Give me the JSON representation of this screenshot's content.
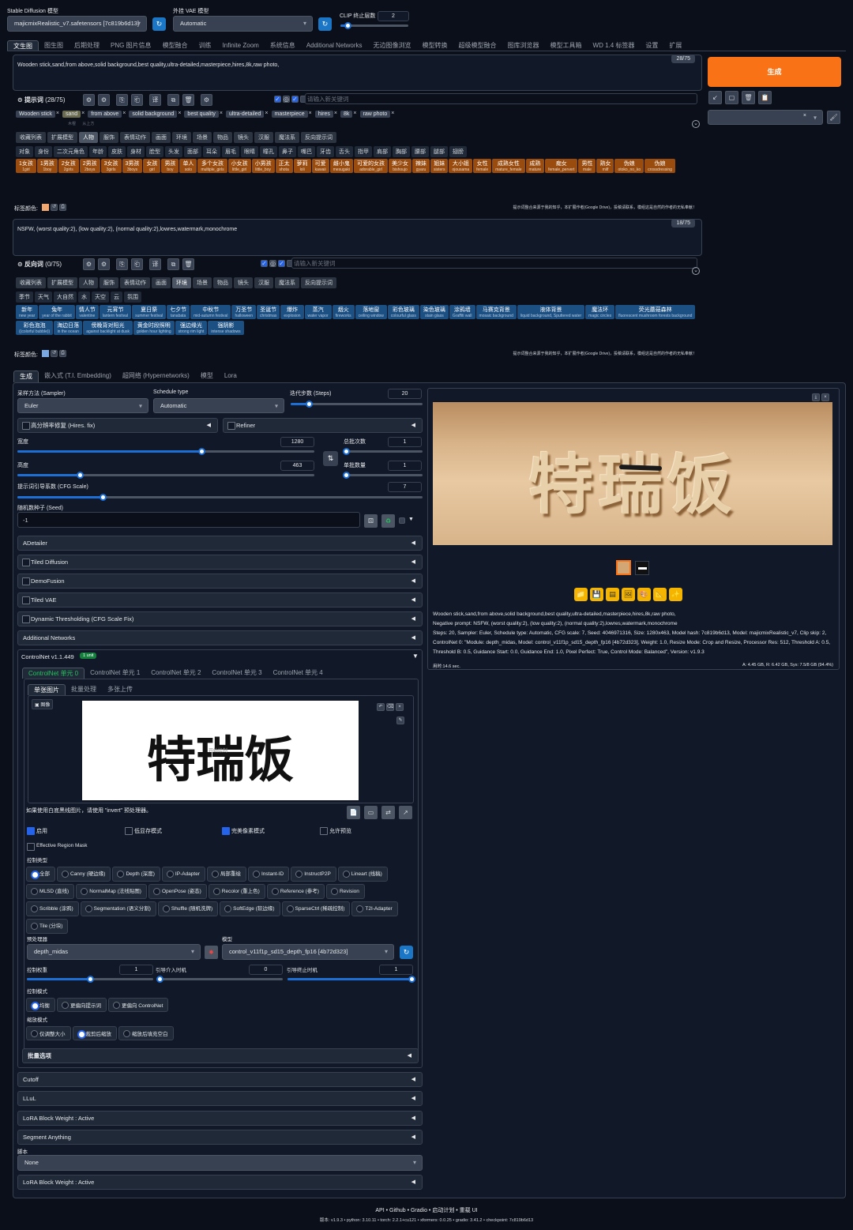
{
  "header": {
    "sd_model_label": "Stable Diffusion 模型",
    "sd_model_value": "majicmixRealistic_v7.safetensors [7c819b6d13]",
    "vae_label": "外挂 VAE 模型",
    "vae_value": "Automatic",
    "clip_label": "CLIP 终止层数",
    "clip_value": "2"
  },
  "tabs": [
    "文生图",
    "图生图",
    "后期处理",
    "PNG 图片信息",
    "模型融合",
    "训练",
    "Infinite Zoom",
    "系统信息",
    "Additional Networks",
    "无边图像浏览",
    "模型转换",
    "超级模型融合",
    "图库浏览器",
    "模型工具箱",
    "WD 1.4 标签器",
    "设置",
    "扩展"
  ],
  "prompt": {
    "text": "Wooden stick,sand,from above,solid background,best quality,ultra-detailed,masterpiece,hires,8k,raw photo,",
    "count": "28/75",
    "label": "提示词",
    "label_count": "(28/75)",
    "keyword_placeholder": "请输入新关键词",
    "chips": [
      "Wooden stick",
      "sand",
      "from above",
      "solid background",
      "best quality",
      "ultra-detailed",
      "masterpiece",
      "hires",
      "8k",
      "raw photo"
    ],
    "chip_subs": [
      "木棍",
      "沙子",
      "从上方"
    ],
    "categories": [
      "收藏列表",
      "扩展模型",
      "人物",
      "服饰",
      "表情动作",
      "画面",
      "环境",
      "场景",
      "物品",
      "镜头",
      "汉服",
      "魔法系",
      "反向提示词"
    ],
    "subcats": [
      "对象",
      "身份",
      "二次元角色",
      "年龄",
      "皮肤",
      "身材",
      "脸型",
      "头发",
      "面部",
      "耳朵",
      "眉毛",
      "眼睛",
      "瞳孔",
      "鼻子",
      "嘴巴",
      "牙齿",
      "舌头",
      "指甲",
      "肩部",
      "胸部",
      "腰部",
      "腿部",
      "翅膀"
    ],
    "tags": [
      [
        "1女孩",
        "1girl"
      ],
      [
        "1男孩",
        "1boy"
      ],
      [
        "2女孩",
        "2girls"
      ],
      [
        "2男孩",
        "2boys"
      ],
      [
        "3女孩",
        "3girls"
      ],
      [
        "3男孩",
        "3boys"
      ],
      [
        "女孩",
        "girl"
      ],
      [
        "男孩",
        "boy"
      ],
      [
        "单人",
        "solo"
      ],
      [
        "多个女孩",
        "multiple_girls"
      ],
      [
        "小女孩",
        "little_girl"
      ],
      [
        "小男孩",
        "little_boy"
      ],
      [
        "正太",
        "shota"
      ],
      [
        "萝莉",
        "loli"
      ],
      [
        "可爱",
        "kawaii"
      ],
      [
        "雌小鬼",
        "mesugaki"
      ],
      [
        "可爱的女孩",
        "adorable_girl"
      ],
      [
        "美少女",
        "bishoujo"
      ],
      [
        "辣妹",
        "gyaru"
      ],
      [
        "姐妹",
        "sisters"
      ],
      [
        "大小姐",
        "ojousama"
      ],
      [
        "女性",
        "female"
      ],
      [
        "成熟女性",
        "mature_female"
      ],
      [
        "成熟",
        "mature"
      ],
      [
        "痴女",
        "female_pervert"
      ],
      [
        "男性",
        "male"
      ],
      [
        "熟女",
        "milf"
      ],
      [
        "伪娘",
        "otoko_no_ko"
      ],
      [
        "伪娘",
        "crossdressing"
      ]
    ],
    "color_label": "标签颜色:",
    "notice": "提示词整合来源于我的知乎，本扩展作者(Google Drive)，投稿请联系，模组这是自然的作者的无私奉献！"
  },
  "negative": {
    "text": "NSFW, (worst quality:2), (low quality:2), (normal quality:2),lowres,watermark,monochrome",
    "count": "18/75",
    "label": "反向词",
    "label_count": "(0/75)",
    "keyword_placeholder": "请输入新关键词",
    "categories": [
      "收藏列表",
      "扩展模型",
      "人物",
      "服饰",
      "表情动作",
      "画面",
      "环境",
      "场景",
      "物品",
      "镜头",
      "汉服",
      "魔法系",
      "反向提示词"
    ],
    "subcats": [
      "季节",
      "天气",
      "大自然",
      "水",
      "天空",
      "云",
      "氛围"
    ],
    "tags": [
      [
        "新年",
        "new year"
      ],
      [
        "兔年",
        "year of the rabbit"
      ],
      [
        "情人节",
        "valentine"
      ],
      [
        "元宵节",
        "lantern festival"
      ],
      [
        "夏日祭",
        "summer festival"
      ],
      [
        "七夕节",
        "tanabata"
      ],
      [
        "中秋节",
        "mid-autumn festival"
      ],
      [
        "万圣节",
        "halloween"
      ],
      [
        "圣诞节",
        "christmas"
      ],
      [
        "爆炸",
        "explosion"
      ],
      [
        "蒸汽",
        "water vapor"
      ],
      [
        "烟火",
        "fireworks"
      ],
      [
        "落地窗",
        "ceiling window"
      ],
      [
        "彩色玻璃",
        "colourful glass"
      ],
      [
        "染色玻璃",
        "stain glass"
      ],
      [
        "涂鸦墙",
        "Graffiti wall"
      ],
      [
        "马赛克背景",
        "mosaic background"
      ],
      [
        "液体背景",
        "liquid background, Sputtered water"
      ],
      [
        "魔法环",
        "magic circles"
      ],
      [
        "荧光蘑菇森林",
        "fluorescent mushroom forests background"
      ],
      [
        "彩色泡泡",
        "((colorful bubble))"
      ],
      [
        "海边日落",
        "in the ocean"
      ],
      [
        "傍晚背对阳光",
        "against backlight at dusk"
      ],
      [
        "黄金时段照明",
        "golden hour lighting"
      ],
      [
        "强边缘光",
        "strong rim light"
      ],
      [
        "强阴影",
        "intense shadows"
      ]
    ],
    "color_label": "标签颜色:"
  },
  "generate_label": "生成",
  "gen_tabs": [
    "生成",
    "嵌入式 (T.I. Embedding)",
    "超网络 (Hypernetworks)",
    "模型",
    "Lora"
  ],
  "params": {
    "sampler_label": "采样方法 (Sampler)",
    "sampler": "Euler",
    "schedule_label": "Schedule type",
    "schedule": "Automatic",
    "steps_label": "迭代步数 (Steps)",
    "steps": "20",
    "hires_label": "高分辨率修复 (Hires. fix)",
    "refiner_label": "Refiner",
    "width_label": "宽度",
    "width": "1280",
    "height_label": "高度",
    "height": "463",
    "batch_count_label": "总批次数",
    "batch_count": "1",
    "batch_size_label": "单批数量",
    "batch_size": "1",
    "cfg_label": "提示词引导系数 (CFG Scale)",
    "cfg": "7",
    "seed_label": "随机数种子 (Seed)",
    "seed": "-1"
  },
  "accordions": [
    "ADetailer",
    "Tiled Diffusion",
    "DemoFusion",
    "Tiled VAE",
    "Dynamic Thresholding (CFG Scale Fix)",
    "Additional Networks"
  ],
  "controlnet": {
    "title": "ControlNet v1.1.449",
    "badge": "1 unit",
    "units": [
      "ControlNet 单元 0",
      "ControlNet 单元 1",
      "ControlNet 单元 2",
      "ControlNet 单元 3",
      "ControlNet 单元 4"
    ],
    "subtabs": [
      "单张图片",
      "批量处理",
      "多张上传"
    ],
    "image_label": "图像",
    "image_text": "特瑞饭",
    "image_hint": "开始绘制",
    "invert_note": "如果使用白底黑线图片，请使用 \"invert\" 预处理器。",
    "enable": "启用",
    "lowvram": "低显存模式",
    "pixel_perfect": "完美像素模式",
    "allow_preview": "允许预览",
    "effective_mask": "Effective Region Mask",
    "control_type_label": "控制类型",
    "control_types": [
      "全部",
      "Canny (硬边缘)",
      "Depth (深度)",
      "IP-Adapter",
      "局部重绘",
      "Instant-ID",
      "InstructP2P",
      "Lineart (线稿)",
      "MLSD (直线)",
      "NormalMap (法线贴图)",
      "OpenPose (姿态)",
      "Recolor (重上色)",
      "Reference (参考)",
      "Revision",
      "Scribble (涂鸦)",
      "Segmentation (语义分割)",
      "Shuffle (随机洗牌)",
      "SoftEdge (软边缘)",
      "SparseCtrl (稀疏控制)",
      "T2I-Adapter",
      "Tile (分块)"
    ],
    "preprocessor_label": "预处理器",
    "preprocessor": "depth_midas",
    "model_label": "模型",
    "model": "control_v11f1p_sd15_depth_fp16 [4b72d323]",
    "weight_label": "控制权重",
    "weight": "1",
    "start_label": "引导介入时机",
    "start": "0",
    "end_label": "引导终止时机",
    "end": "1",
    "mode_label": "控制模式",
    "modes": [
      "均衡",
      "更偏向提示词",
      "更偏向 ControlNet"
    ],
    "resize_label": "缩放模式",
    "resize_modes": [
      "仅调整大小",
      "裁剪后缩放",
      "缩放后填充空白"
    ],
    "batch_label": "批量选项"
  },
  "accordions2": [
    "Cutoff",
    "LLuL",
    "LoRA Block Weight : Active",
    "Segment Anything"
  ],
  "script_label": "脚本",
  "script_value": "None",
  "accordion_last": "LoRA Block Weight : Active",
  "output": {
    "image_text": "特瑞饭",
    "info_prompt": "Wooden stick,sand,from above,solid background,best quality,ultra-detailed,masterpiece,hires,8k,raw photo,",
    "info_negative": "Negative prompt: NSFW, (worst quality:2), (low quality:2), (normal quality:2),lowres,watermark,monochrome",
    "info_params": "Steps: 20, Sampler: Euler, Schedule type: Automatic, CFG scale: 7, Seed: 4046971316, Size: 1280x463, Model hash: 7c819b6d13, Model: majicmixRealistic_v7, Clip skip: 2, ControlNet 0: \"Module: depth_midas, Model: control_v11f1p_sd15_depth_fp16 [4b72d323], Weight: 1.0, Resize Mode: Crop and Resize, Processor Res: 512, Threshold A: 0.5, Threshold B: 0.5, Guidance Start: 0.0, Guidance End: 1.0, Pixel Perfect: True, Control Mode: Balanced\", Version: v1.9.3",
    "time": "用时:14.6 sec.",
    "mem": "A: 4.45 GB, R: 6.42 GB, Sys: 7.5/8 GB (94.4%)"
  },
  "footer": {
    "links": [
      "API",
      "Github",
      "Gradio",
      "启动计划",
      "重载 UI"
    ],
    "versions": "版本: v1.9.3  •  python: 3.10.11  •  torch: 2.2.1+cu121  •  xformers: 0.0.25  •  gradio: 3.41.2  •  checkpoint: 7c819b6d13"
  },
  "colors": {
    "accent": "#f97316",
    "blue": "#1b77c5",
    "tag_orange": "#9a4c0e",
    "tag_blue": "#1c4f82"
  }
}
